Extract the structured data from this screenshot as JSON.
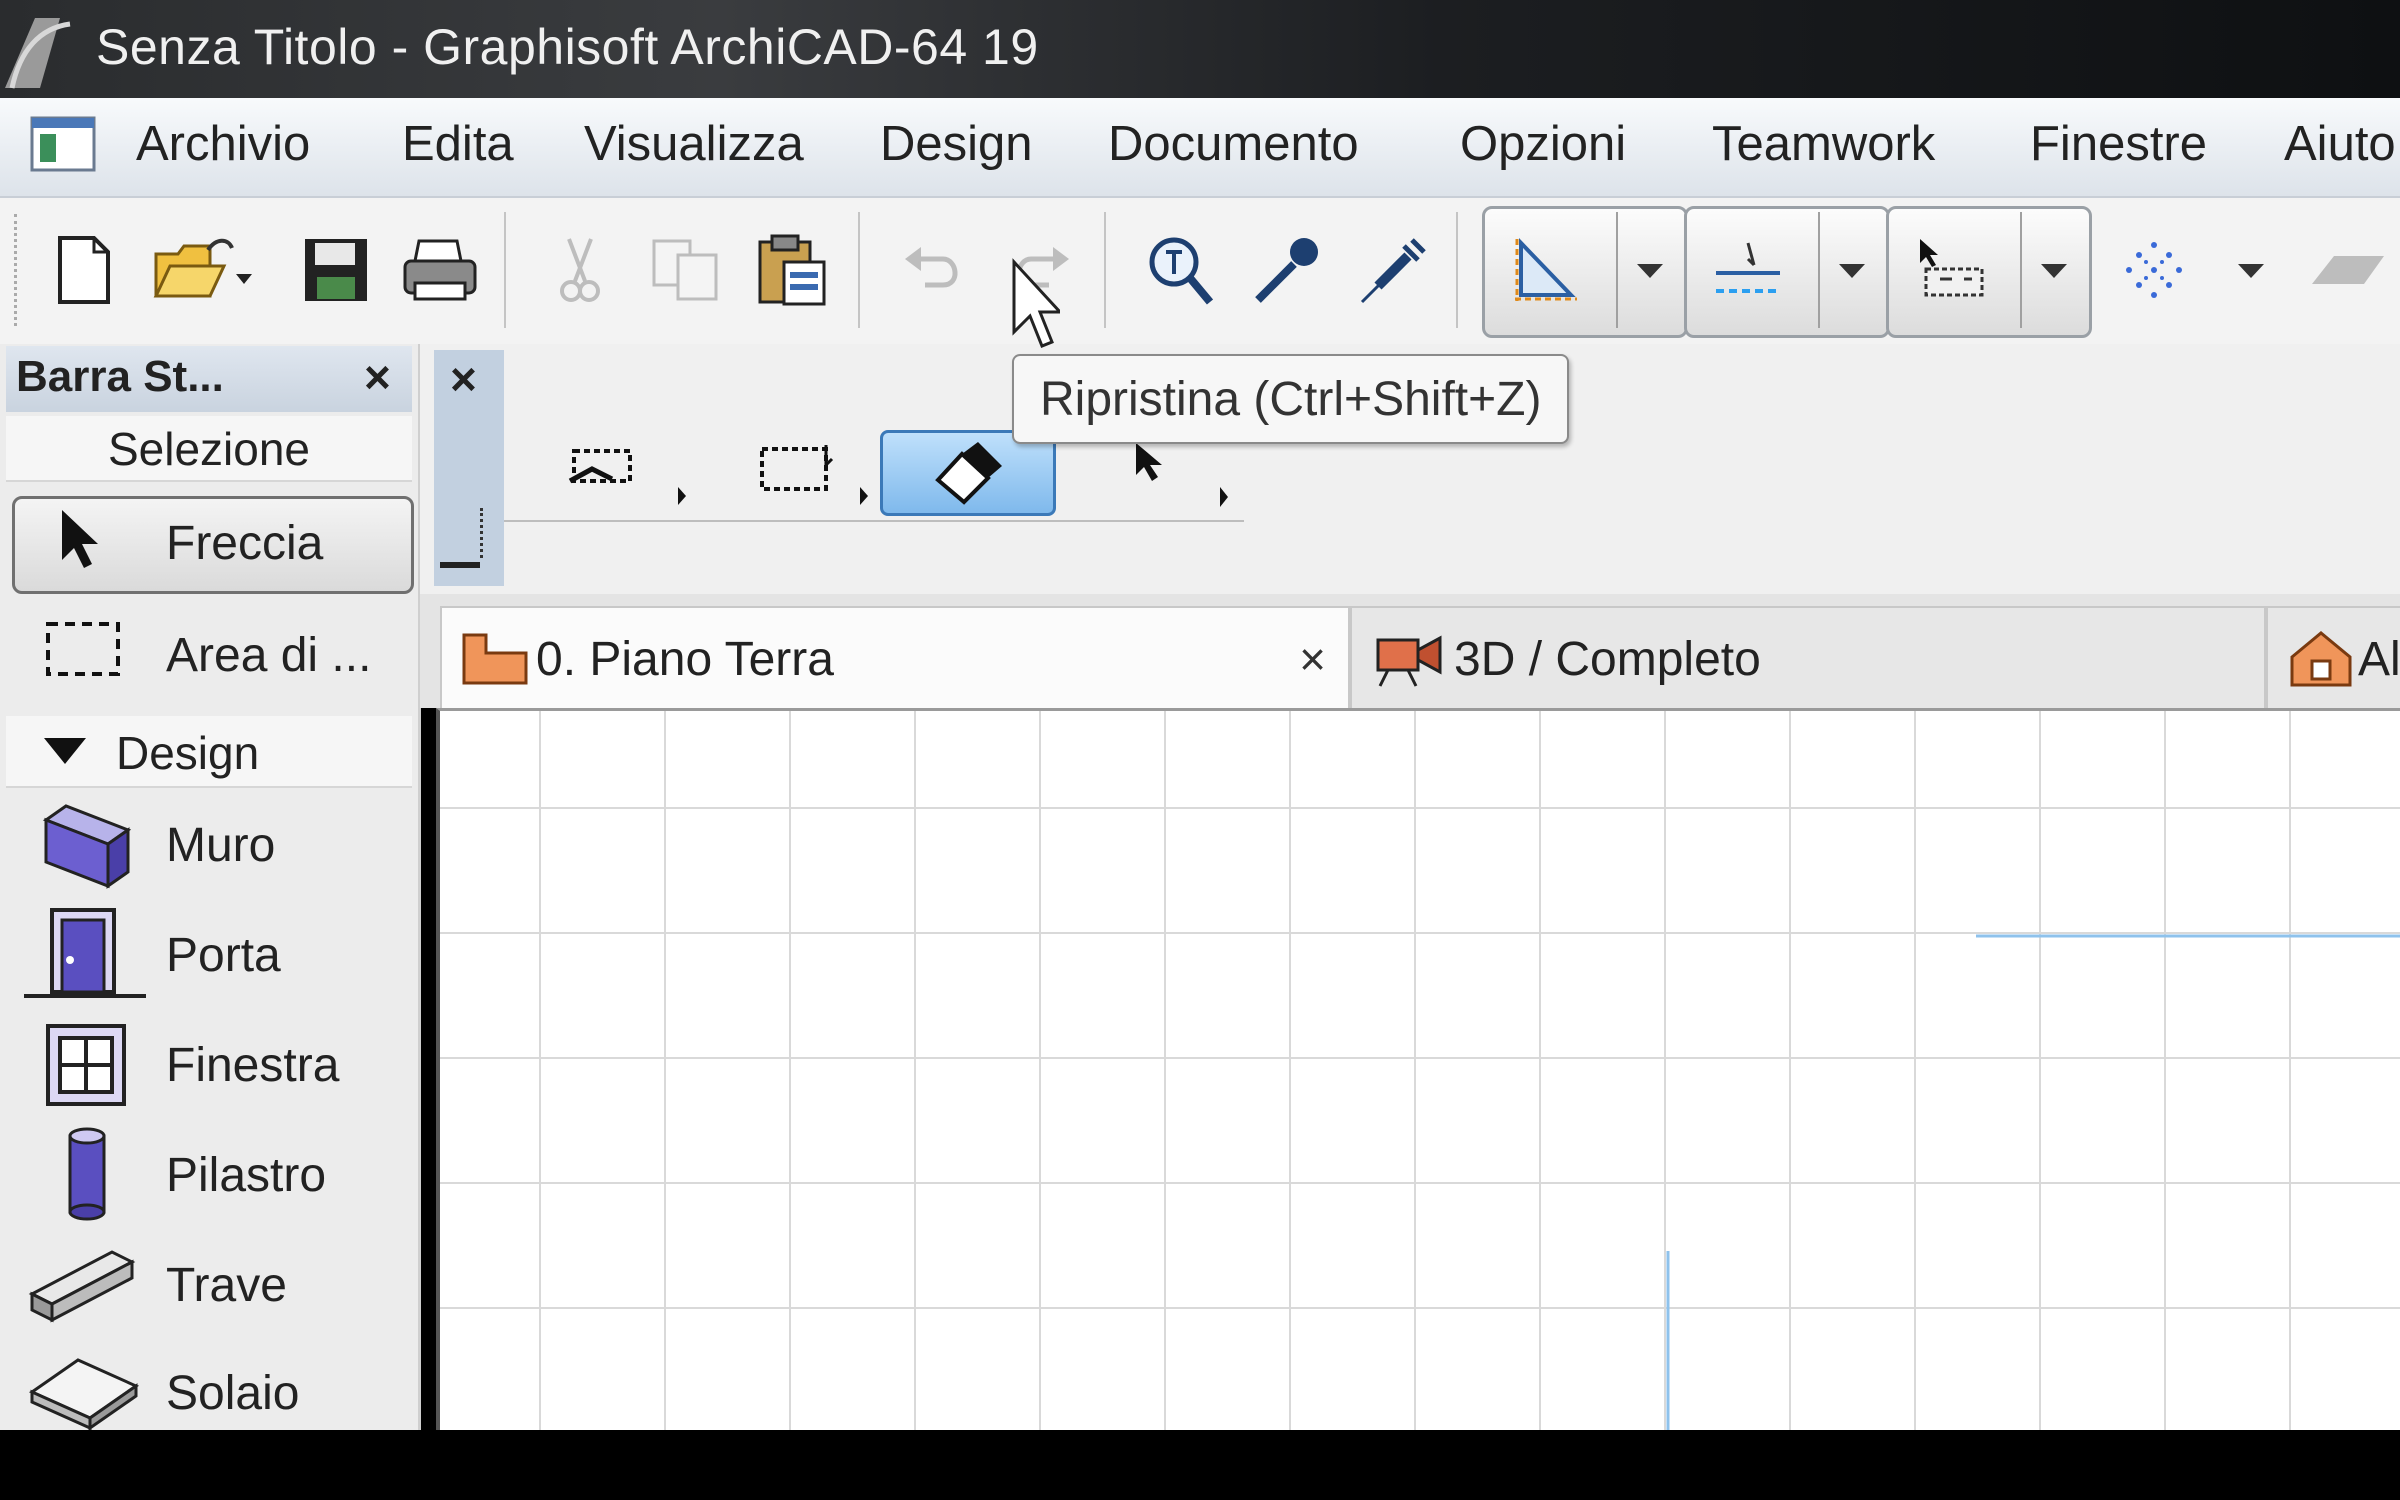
{
  "window": {
    "title": "Senza Titolo - Graphisoft ArchiCAD-64 19"
  },
  "menu": {
    "items": [
      "Archivio",
      "Edita",
      "Visualizza",
      "Design",
      "Documento",
      "Opzioni",
      "Teamwork",
      "Finestre",
      "Aiuto"
    ]
  },
  "toolbar": {
    "buttons": [
      "new-file",
      "open-file",
      "save",
      "print",
      "cut",
      "copy",
      "paste",
      "undo",
      "redo",
      "find-select",
      "eyedropper",
      "syringe"
    ]
  },
  "tooltip": {
    "text": "Ripristina (Ctrl+Shift+Z)"
  },
  "palette": {
    "title": "Barra St...",
    "close": "×",
    "section_selection": "Selezione",
    "section_design": "Design",
    "tools": {
      "freccia": "Freccia",
      "area": "Area di ...",
      "muro": "Muro",
      "porta": "Porta",
      "finestra": "Finestra",
      "pilastro": "Pilastro",
      "trave": "Trave",
      "solaio": "Solaio"
    }
  },
  "infobox": {
    "close": "×"
  },
  "tabs": {
    "piano": "0. Piano Terra",
    "piano_close": "×",
    "view3d": "3D / Completo",
    "alzato": "Al"
  },
  "colors": {
    "accent": "#3b79b8",
    "grid": "#d9d9d9",
    "guide": "#8ec2ec"
  }
}
